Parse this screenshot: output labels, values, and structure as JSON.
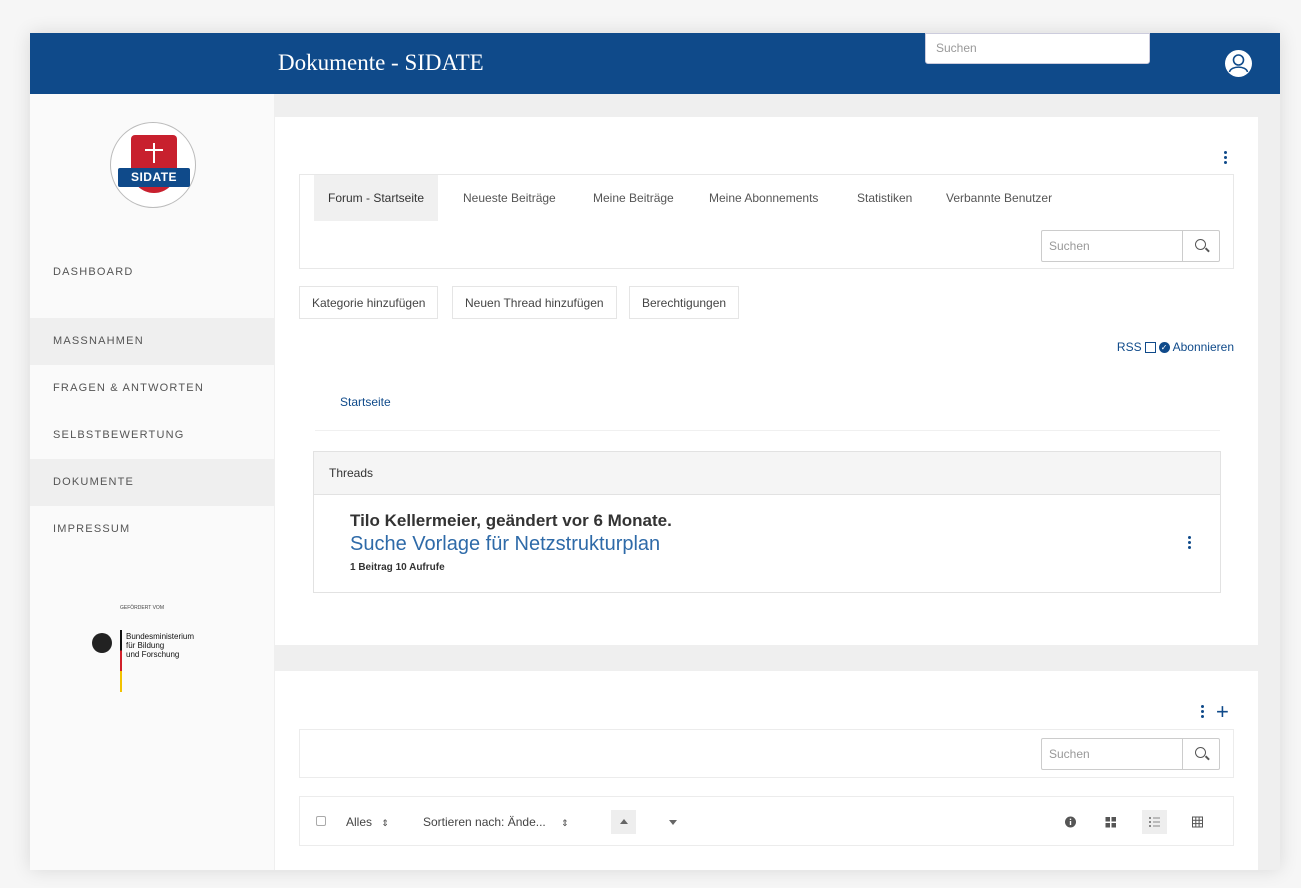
{
  "header": {
    "title": "Dokumente - SIDATE",
    "search_placeholder": "Suchen"
  },
  "sidebar": {
    "logo_text": "SIDATE",
    "items": [
      {
        "label": "DASHBOARD"
      },
      {
        "label": "MASSNAHMEN"
      },
      {
        "label": "FRAGEN & ANTWORTEN"
      },
      {
        "label": "SELBSTBEWERTUNG"
      },
      {
        "label": "DOKUMENTE"
      },
      {
        "label": "IMPRESSUM"
      }
    ],
    "sponsor_label": "GEFÖRDERT VOM",
    "sponsor_line1": "Bundesministerium",
    "sponsor_line2": "für Bildung",
    "sponsor_line3": "und Forschung"
  },
  "forum": {
    "tabs": [
      {
        "label": "Forum - Startseite"
      },
      {
        "label": "Neueste Beiträge"
      },
      {
        "label": "Meine Beiträge"
      },
      {
        "label": "Meine Abonnements"
      },
      {
        "label": "Statistiken"
      },
      {
        "label": "Verbannte Benutzer"
      }
    ],
    "search_placeholder": "Suchen",
    "actions": [
      {
        "label": "Kategorie hinzufügen"
      },
      {
        "label": "Neuen Thread hinzufügen"
      },
      {
        "label": "Berechtigungen"
      }
    ],
    "rss_label": "RSS",
    "subscribe_label": "Abonnieren",
    "breadcrumb": "Startseite",
    "threads_header": "Threads",
    "thread": {
      "meta": "Tilo Kellermeier, geändert vor 6 Monate.",
      "title": "Suche Vorlage für Netzstrukturplan",
      "stats": "1 Beitrag  10 Aufrufe"
    }
  },
  "documents": {
    "search_placeholder": "Suchen",
    "select_label": "Alles",
    "sort_label": "Sortieren nach: Ände...",
    "arrows_glyph": "⇕"
  },
  "colors": {
    "brand": "#0f4a8a",
    "accent_red": "#c8202e",
    "link": "#2e6aa8"
  }
}
